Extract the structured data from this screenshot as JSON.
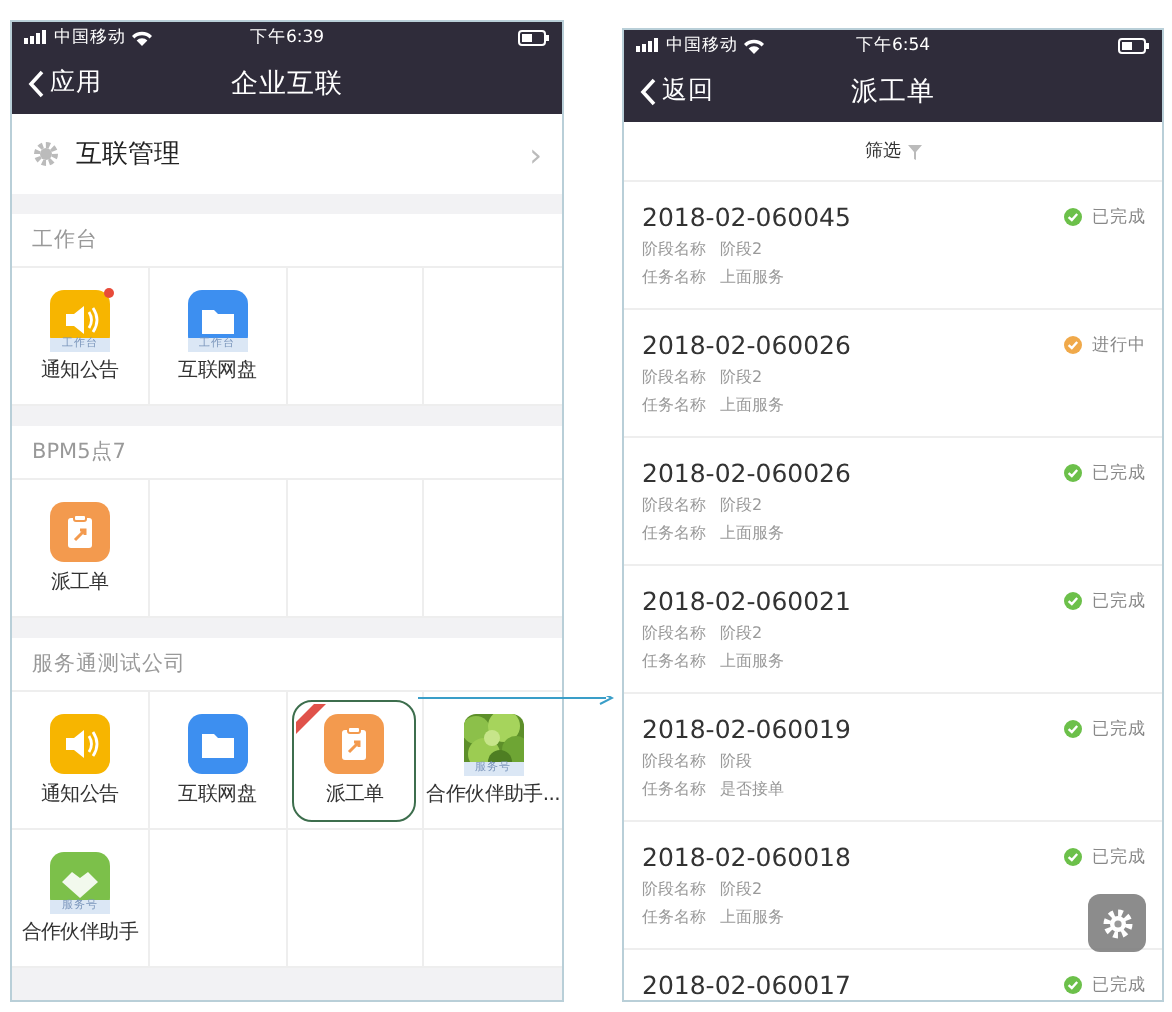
{
  "left_phone": {
    "status_bar": {
      "carrier": "中国移动",
      "time": "下午6:39"
    },
    "nav": {
      "back": "应用",
      "title": "企业互联"
    },
    "manage_row": {
      "label": "互联管理",
      "chevron": "›"
    },
    "sections": [
      {
        "title": "工作台",
        "tiles": [
          {
            "label": "通知公告",
            "kind": "notice",
            "badge": "工作台",
            "dot": true,
            "highlighted": false
          },
          {
            "label": "互联网盘",
            "kind": "disk",
            "badge": "工作台",
            "dot": false,
            "highlighted": false
          }
        ]
      },
      {
        "title": "BPM5点7",
        "tiles": [
          {
            "label": "派工单",
            "kind": "dispatch",
            "dot": false,
            "highlighted": false
          }
        ]
      },
      {
        "title": "服务通测试公司",
        "tiles": [
          {
            "label": "通知公告",
            "kind": "notice",
            "dot": false,
            "highlighted": false
          },
          {
            "label": "互联网盘",
            "kind": "disk",
            "dot": false,
            "highlighted": false
          },
          {
            "label": "派工单",
            "kind": "dispatch",
            "dot": false,
            "highlighted": true
          },
          {
            "label": "合作伙伴助手...",
            "kind": "partner_photo",
            "badge": "服务号",
            "dot": false,
            "highlighted": false
          },
          {
            "label": "合作伙伴助手",
            "kind": "partner",
            "badge": "服务号",
            "dot": false,
            "highlighted": false
          }
        ]
      }
    ]
  },
  "right_phone": {
    "status_bar": {
      "carrier": "中国移动",
      "time": "下午6:54"
    },
    "nav": {
      "back": "返回",
      "title": "派工单"
    },
    "filter": {
      "label": "筛选"
    },
    "orders": [
      {
        "number": "2018-02-060045",
        "status": "已完成",
        "kind": "done",
        "lines": [
          {
            "label": "阶段名称",
            "value": "阶段2"
          },
          {
            "label": "任务名称",
            "value": "上面服务"
          }
        ]
      },
      {
        "number": "2018-02-060026",
        "status": "进行中",
        "kind": "progress",
        "lines": [
          {
            "label": "阶段名称",
            "value": "阶段2"
          },
          {
            "label": "任务名称",
            "value": "上面服务"
          }
        ]
      },
      {
        "number": "2018-02-060026",
        "status": "已完成",
        "kind": "done",
        "lines": [
          {
            "label": "阶段名称",
            "value": "阶段2"
          },
          {
            "label": "任务名称",
            "value": "上面服务"
          }
        ]
      },
      {
        "number": "2018-02-060021",
        "status": "已完成",
        "kind": "done",
        "lines": [
          {
            "label": "阶段名称",
            "value": "阶段2"
          },
          {
            "label": "任务名称",
            "value": "上面服务"
          }
        ]
      },
      {
        "number": "2018-02-060019",
        "status": "已完成",
        "kind": "done",
        "lines": [
          {
            "label": "阶段名称",
            "value": "阶段"
          },
          {
            "label": "任务名称",
            "value": "是否接单"
          }
        ]
      },
      {
        "number": "2018-02-060018",
        "status": "已完成",
        "kind": "done",
        "lines": [
          {
            "label": "阶段名称",
            "value": "阶段2"
          },
          {
            "label": "任务名称",
            "value": "上面服务"
          }
        ]
      },
      {
        "number": "2018-02-060017",
        "status": "已完成",
        "kind": "done"
      }
    ]
  }
}
